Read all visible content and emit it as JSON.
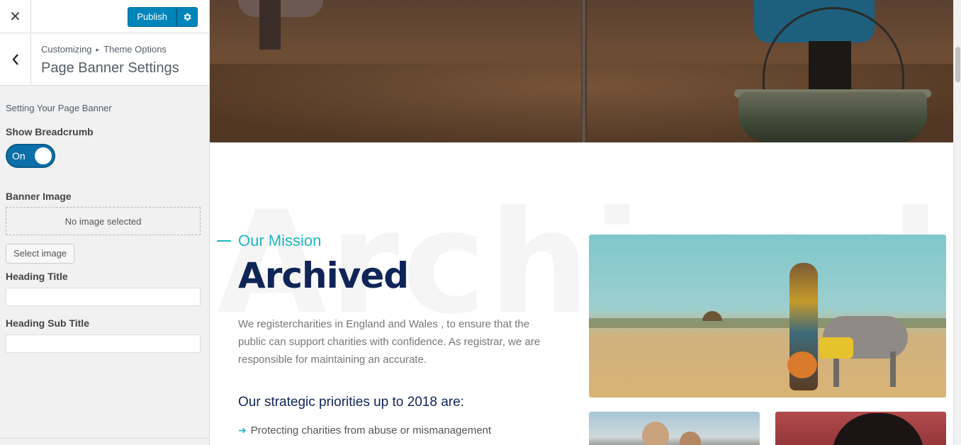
{
  "sidebar": {
    "publish_label": "Publish",
    "breadcrumb": {
      "root": "Customizing",
      "separator": "▸",
      "parent": "Theme Options"
    },
    "section_title": "Page Banner Settings",
    "description": "Setting Your Page Banner",
    "show_breadcrumb": {
      "label": "Show Breadcrumb",
      "state_text": "On",
      "enabled": true
    },
    "banner_image": {
      "label": "Banner Image",
      "placeholder": "No image selected",
      "button": "Select image"
    },
    "heading_title": {
      "label": "Heading Title",
      "value": ""
    },
    "heading_sub_title": {
      "label": "Heading Sub Title",
      "value": ""
    }
  },
  "preview": {
    "ghost_word": "Archived",
    "kicker": "Our Mission",
    "headline": "Archived",
    "paragraph": "We registercharities in England and Wales , to ensure that the public can support charities with confidence. As registrar, we are responsible for maintaining an accurate.",
    "subheading": "Our strategic priorities up to 2018 are:",
    "bullets": [
      "Protecting charities from abuse or mismanagement"
    ]
  },
  "colors": {
    "accent": "#1fb6c4",
    "heading": "#0f2557",
    "publish": "#0085ba",
    "toggle": "#0b6fa8"
  }
}
